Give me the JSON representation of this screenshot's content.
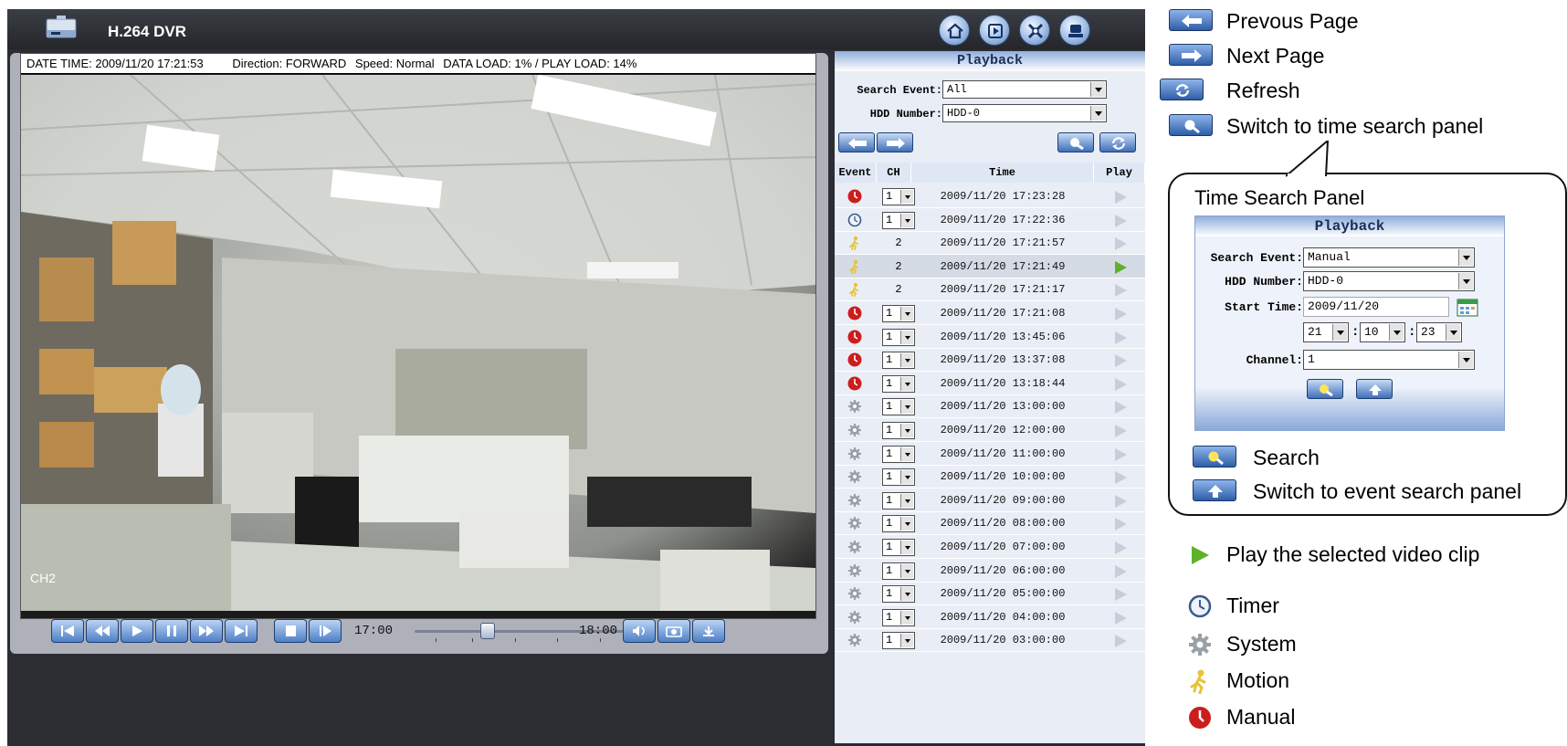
{
  "window": {
    "title": "H.264 DVR",
    "top_buttons": [
      "home-icon",
      "record-icon",
      "tools-icon",
      "network-icon"
    ]
  },
  "video": {
    "date_time": "DATE TIME: 2009/11/20 17:21:53",
    "direction": "Direction: FORWARD",
    "speed": "Speed: Normal",
    "load": "DATA LOAD: 1% / PLAY LOAD: 14%",
    "channel_label": "CH2"
  },
  "controls": {
    "start_time": "17:00",
    "end_time": "18:00",
    "timeline_position_fraction": 0.34
  },
  "playback": {
    "title": "Playback",
    "search_event_label": "Search Event:",
    "search_event_value": "All",
    "hdd_label": "HDD Number:",
    "hdd_value": "HDD-0",
    "columns": [
      "Event",
      "CH",
      "Time",
      "Play"
    ],
    "rows": [
      {
        "event": "manual",
        "ch": "1",
        "ch_select": true,
        "time": "2009/11/20 17:23:28",
        "selected": false
      },
      {
        "event": "timer",
        "ch": "1",
        "ch_select": true,
        "time": "2009/11/20 17:22:36",
        "selected": false
      },
      {
        "event": "motion",
        "ch": "2",
        "ch_select": false,
        "time": "2009/11/20 17:21:57",
        "selected": false
      },
      {
        "event": "motion",
        "ch": "2",
        "ch_select": false,
        "time": "2009/11/20 17:21:49",
        "selected": true
      },
      {
        "event": "motion",
        "ch": "2",
        "ch_select": false,
        "time": "2009/11/20 17:21:17",
        "selected": false
      },
      {
        "event": "manual",
        "ch": "1",
        "ch_select": true,
        "time": "2009/11/20 17:21:08",
        "selected": false
      },
      {
        "event": "manual",
        "ch": "1",
        "ch_select": true,
        "time": "2009/11/20 13:45:06",
        "selected": false
      },
      {
        "event": "manual",
        "ch": "1",
        "ch_select": true,
        "time": "2009/11/20 13:37:08",
        "selected": false
      },
      {
        "event": "manual",
        "ch": "1",
        "ch_select": true,
        "time": "2009/11/20 13:18:44",
        "selected": false
      },
      {
        "event": "system",
        "ch": "1",
        "ch_select": true,
        "time": "2009/11/20 13:00:00",
        "selected": false
      },
      {
        "event": "system",
        "ch": "1",
        "ch_select": true,
        "time": "2009/11/20 12:00:00",
        "selected": false
      },
      {
        "event": "system",
        "ch": "1",
        "ch_select": true,
        "time": "2009/11/20 11:00:00",
        "selected": false
      },
      {
        "event": "system",
        "ch": "1",
        "ch_select": true,
        "time": "2009/11/20 10:00:00",
        "selected": false
      },
      {
        "event": "system",
        "ch": "1",
        "ch_select": true,
        "time": "2009/11/20 09:00:00",
        "selected": false
      },
      {
        "event": "system",
        "ch": "1",
        "ch_select": true,
        "time": "2009/11/20 08:00:00",
        "selected": false
      },
      {
        "event": "system",
        "ch": "1",
        "ch_select": true,
        "time": "2009/11/20 07:00:00",
        "selected": false
      },
      {
        "event": "system",
        "ch": "1",
        "ch_select": true,
        "time": "2009/11/20 06:00:00",
        "selected": false
      },
      {
        "event": "system",
        "ch": "1",
        "ch_select": true,
        "time": "2009/11/20 05:00:00",
        "selected": false
      },
      {
        "event": "system",
        "ch": "1",
        "ch_select": true,
        "time": "2009/11/20 04:00:00",
        "selected": false
      },
      {
        "event": "system",
        "ch": "1",
        "ch_select": true,
        "time": "2009/11/20 03:00:00",
        "selected": false
      }
    ]
  },
  "legend": {
    "prev_page": "Prevous Page",
    "next_page": "Next Page",
    "refresh": "Refresh",
    "time_search": "Switch to time search panel",
    "callout_title": "Time Search Panel",
    "search": "Search",
    "event_search": "Switch to event search panel",
    "play_clip": "Play the selected video clip",
    "timer": "Timer",
    "system": "System",
    "motion": "Motion",
    "manual": "Manual"
  },
  "time_search_panel": {
    "title": "Playback",
    "search_event_label": "Search Event:",
    "search_event_value": "Manual",
    "hdd_label": "HDD Number:",
    "hdd_value": "HDD-0",
    "start_time_label": "Start Time:",
    "start_date": "2009/11/20",
    "hour": "21",
    "minute": "10",
    "second": "23",
    "channel_label": "Channel:",
    "channel_value": "1"
  },
  "colors": {
    "manual": "#cc1d1d",
    "motion": "#e8c23a",
    "play_active": "#5db12c",
    "button_blue": "#3f6fb8"
  }
}
